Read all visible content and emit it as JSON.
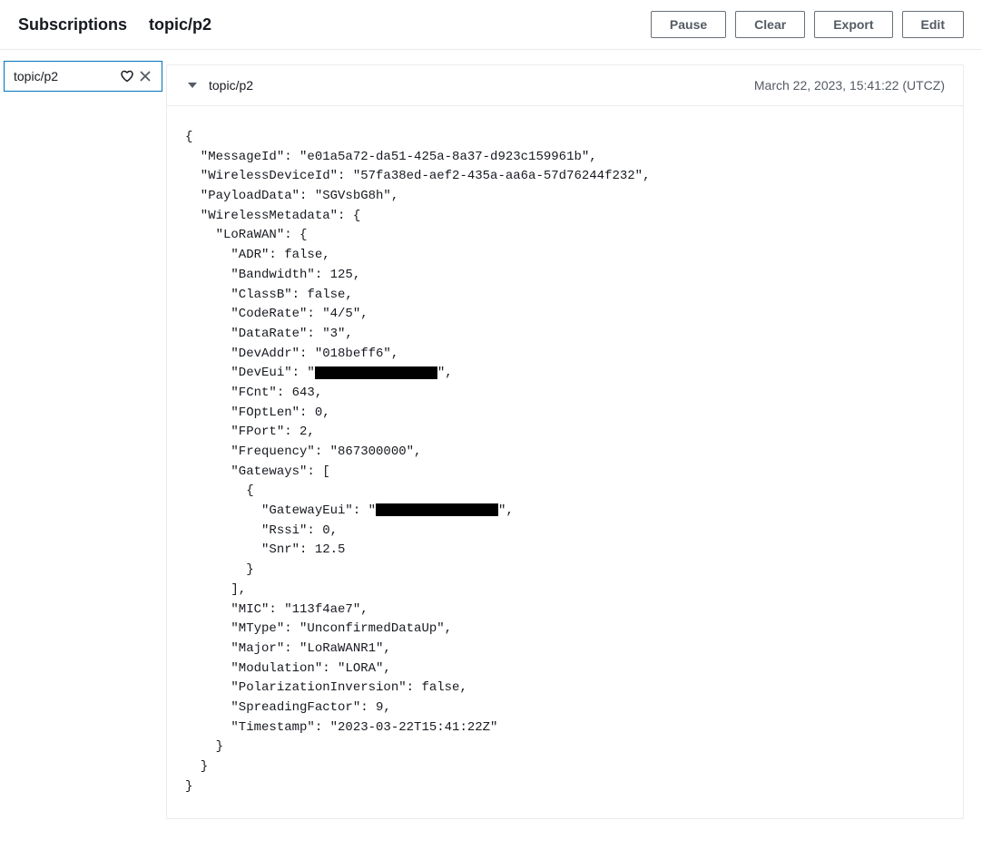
{
  "header": {
    "subscriptions_label": "Subscriptions",
    "topic_title": "topic/p2",
    "actions": {
      "pause": "Pause",
      "clear": "Clear",
      "export": "Export",
      "edit": "Edit"
    }
  },
  "sidebar": {
    "subscription": {
      "label": "topic/p2"
    }
  },
  "message": {
    "topic": "topic/p2",
    "timestamp": "March 22, 2023, 15:41:22 (UTCZ)",
    "json_lines": {
      "l0": "{",
      "l1": "  \"MessageId\": \"e01a5a72-da51-425a-8a37-d923c159961b\",",
      "l2": "  \"WirelessDeviceId\": \"57fa38ed-aef2-435a-aa6a-57d76244f232\",",
      "l3": "  \"PayloadData\": \"SGVsbG8h\",",
      "l4": "  \"WirelessMetadata\": {",
      "l5": "    \"LoRaWAN\": {",
      "l6": "      \"ADR\": false,",
      "l7": "      \"Bandwidth\": 125,",
      "l8": "      \"ClassB\": false,",
      "l9": "      \"CodeRate\": \"4/5\",",
      "l10": "      \"DataRate\": \"3\",",
      "l11": "      \"DevAddr\": \"018beff6\",",
      "l12a": "      \"DevEui\": \"",
      "l12b": "\",",
      "l13": "      \"FCnt\": 643,",
      "l14": "      \"FOptLen\": 0,",
      "l15": "      \"FPort\": 2,",
      "l16": "      \"Frequency\": \"867300000\",",
      "l17": "      \"Gateways\": [",
      "l18": "        {",
      "l19a": "          \"GatewayEui\": \"",
      "l19b": "\",",
      "l20": "          \"Rssi\": 0,",
      "l21": "          \"Snr\": 12.5",
      "l22": "        }",
      "l23": "      ],",
      "l24": "      \"MIC\": \"113f4ae7\",",
      "l25": "      \"MType\": \"UnconfirmedDataUp\",",
      "l26": "      \"Major\": \"LoRaWANR1\",",
      "l27": "      \"Modulation\": \"LORA\",",
      "l28": "      \"PolarizationInversion\": false,",
      "l29": "      \"SpreadingFactor\": 9,",
      "l30": "      \"Timestamp\": \"2023-03-22T15:41:22Z\"",
      "l31": "    }",
      "l32": "  }",
      "l33": "}"
    }
  }
}
